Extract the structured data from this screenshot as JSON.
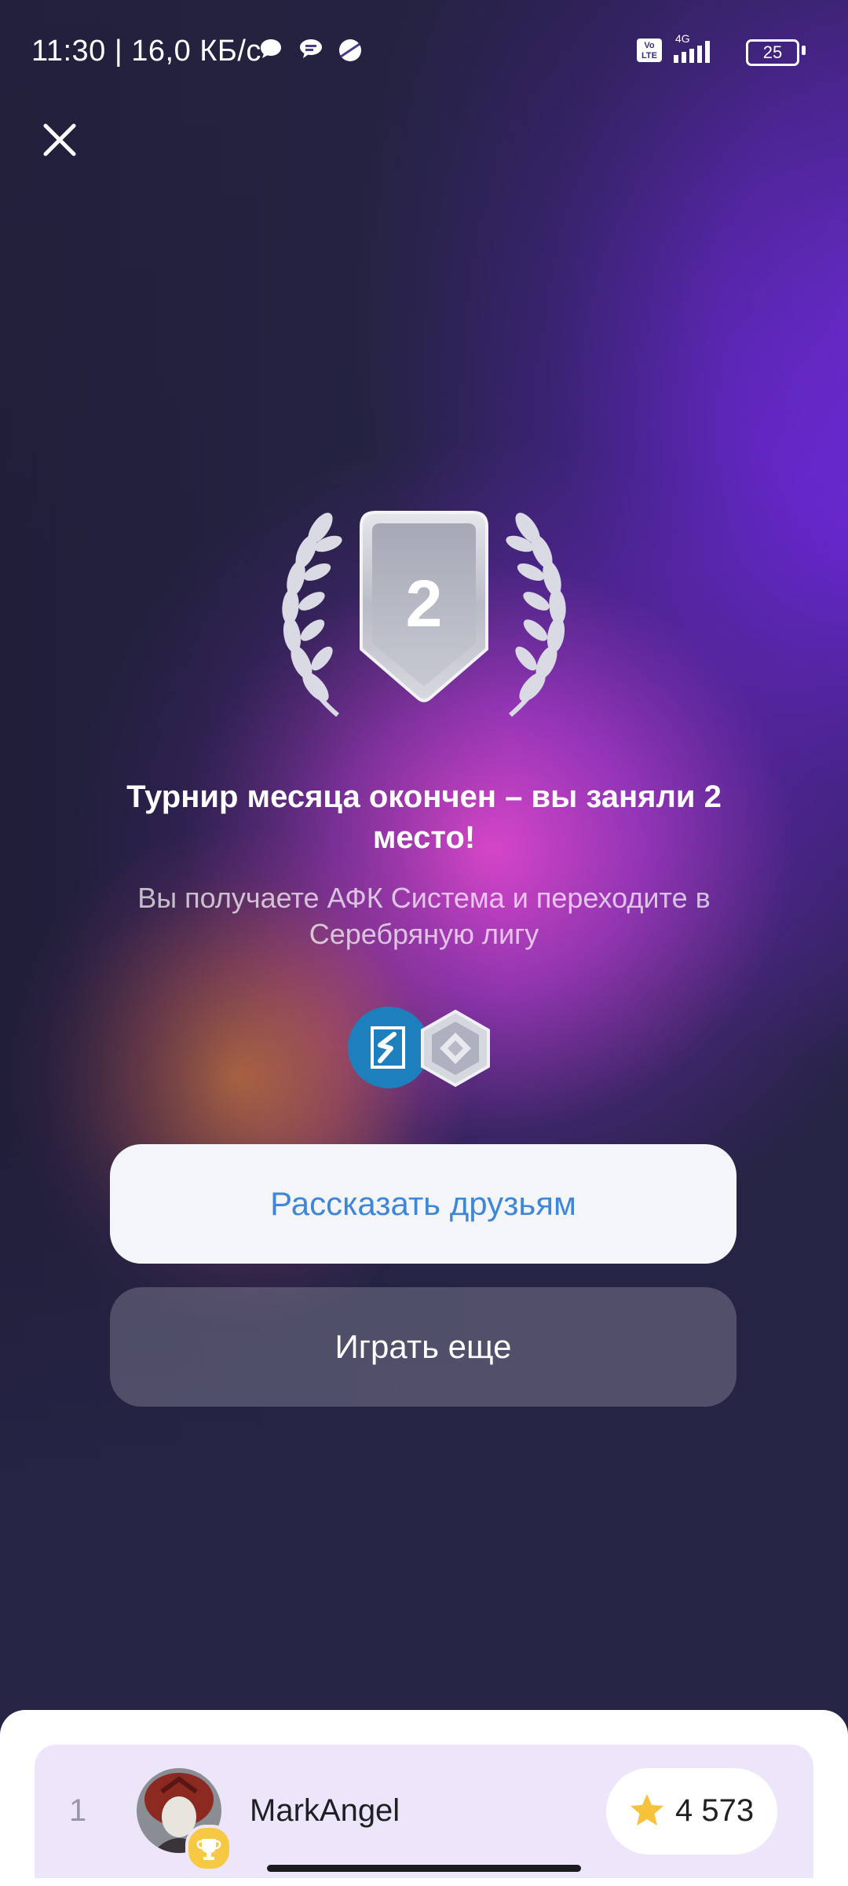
{
  "status_bar": {
    "text": "11:30 | 16,0 КБ/с",
    "network": "4G",
    "volte": "Vo LTE",
    "battery": "25"
  },
  "header": {
    "close_icon": "close-icon"
  },
  "badge": {
    "place_number": "2",
    "icon": "silver-shield-laurel-icon"
  },
  "message": {
    "title": "Турнир месяца окончен – вы заняли 2 место!",
    "subtitle": "Вы получаете АФК Система и переходите в Серебряную лигу"
  },
  "rewards": {
    "company_icon": "afk-sistema-logo-icon",
    "league_icon": "silver-league-icon"
  },
  "buttons": {
    "share_label": "Рассказать друзьям",
    "play_label": "Играть еще"
  },
  "leaderboard": {
    "rows": [
      {
        "rank": "1",
        "name": "MarkAngel",
        "score": "4 573",
        "badge_icon": "trophy-icon"
      }
    ]
  },
  "colors": {
    "accent_link": "#3f87d6",
    "background_dark": "#262445",
    "violet": "#7a2cf2",
    "row_highlight": "#ede6fa",
    "star": "#f7c23b"
  }
}
